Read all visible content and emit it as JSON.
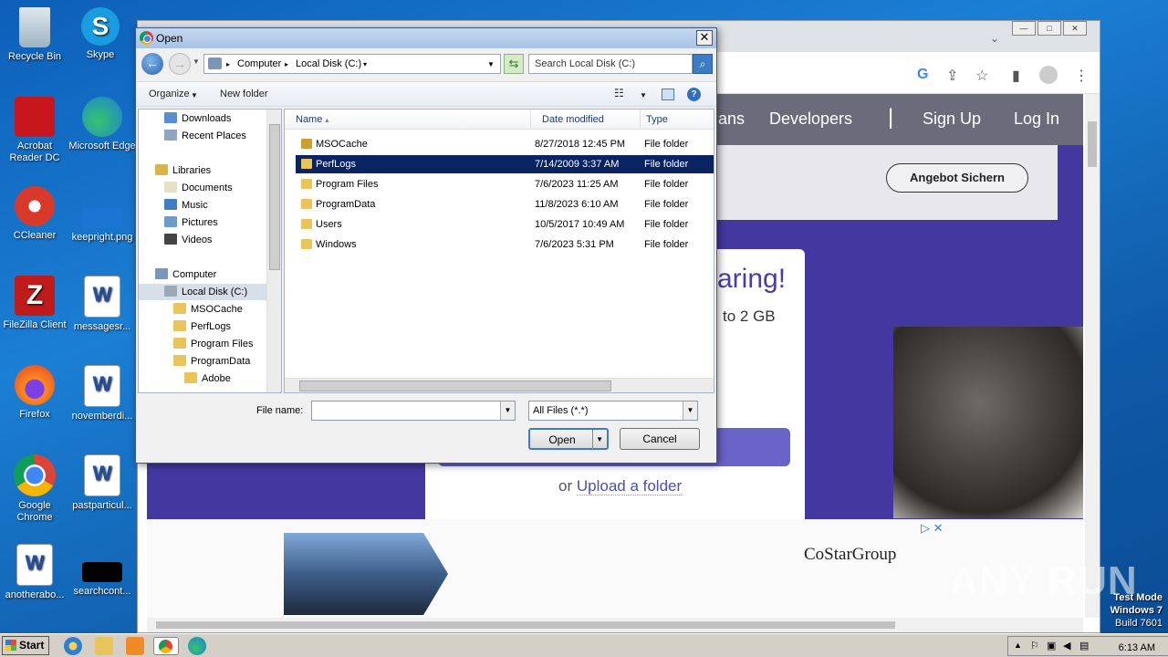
{
  "desktop_icons": [
    {
      "label": "Recycle Bin"
    },
    {
      "label": "Skype"
    },
    {
      "label": "Acrobat Reader DC"
    },
    {
      "label": "Microsoft Edge"
    },
    {
      "label": "CCleaner"
    },
    {
      "label": "keepright.png"
    },
    {
      "label": "FileZilla Client"
    },
    {
      "label": "messagesr..."
    },
    {
      "label": "Firefox"
    },
    {
      "label": "novemberdi..."
    },
    {
      "label": "Google Chrome"
    },
    {
      "label": "pastparticul..."
    },
    {
      "label": "anotherabo..."
    },
    {
      "label": "searchcont..."
    }
  ],
  "browser": {
    "nav": {
      "item1": "ans",
      "developers": "Developers",
      "signup": "Sign Up",
      "login": "Log In"
    },
    "angebot": "Angebot Sichern",
    "headline": "aring!",
    "subline": "to 2 GB",
    "or_text": "or",
    "upload_folder": "Upload a folder",
    "ad_brand": "CoStarGroup",
    "ad_mark": "▷ ✕"
  },
  "dialog": {
    "title": "Open",
    "close": "✕",
    "breadcrumb": {
      "computer": "Computer",
      "disk": "Local Disk (C:)"
    },
    "search_placeholder": "Search Local Disk (C:)",
    "toolbar": {
      "organize": "Organize",
      "new_folder": "New folder"
    },
    "tree": [
      "Downloads",
      "Recent Places",
      "Libraries",
      "Documents",
      "Music",
      "Pictures",
      "Videos",
      "Computer",
      "Local Disk (C:)",
      "MSOCache",
      "PerfLogs",
      "Program Files",
      "ProgramData",
      "Adobe"
    ],
    "columns": {
      "name": "Name",
      "date": "Date modified",
      "type": "Type"
    },
    "files": [
      {
        "name": "MSOCache",
        "date": "8/27/2018 12:45 PM",
        "type": "File folder"
      },
      {
        "name": "PerfLogs",
        "date": "7/14/2009 3:37 AM",
        "type": "File folder"
      },
      {
        "name": "Program Files",
        "date": "7/6/2023 11:25 AM",
        "type": "File folder"
      },
      {
        "name": "ProgramData",
        "date": "11/8/2023 6:10 AM",
        "type": "File folder"
      },
      {
        "name": "Users",
        "date": "10/5/2017 10:49 AM",
        "type": "File folder"
      },
      {
        "name": "Windows",
        "date": "7/6/2023 5:31 PM",
        "type": "File folder"
      }
    ],
    "filename_label": "File name:",
    "filename_value": "",
    "filter_value": "All Files (*.*)",
    "open_label": "Open",
    "cancel_label": "Cancel"
  },
  "taskbar": {
    "start": "Start",
    "clock": "6:13 AM"
  },
  "watermark": "ANY RUN",
  "testmode": {
    "line1": "Test Mode",
    "line2": "Windows 7",
    "line3": "Build 7601"
  }
}
